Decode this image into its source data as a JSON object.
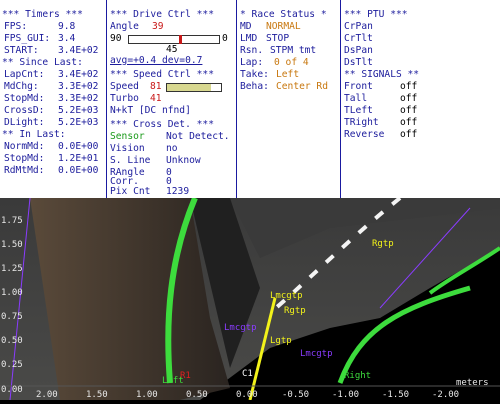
{
  "timers": {
    "title": "*** Timers ***",
    "fps_label": "FPS:",
    "fps": "9.8",
    "fps_gui_label": "FPS_GUI:",
    "fps_gui": "3.4",
    "start_label": "START:",
    "start": "3.4E+02",
    "since_title": "** Since Last:",
    "lapcnt_label": "LapCnt:",
    "lapcnt": "3.4E+02",
    "mdchg_label": "MdChg:",
    "mdchg": "3.3E+02",
    "stopmd_label": "StopMd:",
    "stopmd": "3.3E+02",
    "crossd_label": "CrossD:",
    "crossd": "5.2E+03",
    "dlight_label": "DLight:",
    "dlight": "5.2E+03",
    "inlast_title": "** In Last:",
    "normmd_label": "NormMd:",
    "normmd": "0.0E+00",
    "stopmd2_label": "StopMd:",
    "stopmd2": "1.2E+01",
    "rdmtmd_label": "RdMtMd:",
    "rdmtmd": "0.0E+00"
  },
  "drive": {
    "title": "*** Drive Ctrl ***",
    "angle_label": "Angle",
    "angle": "39",
    "range_min": "90",
    "range_max": "0",
    "mid": "45",
    "avg": "avg=+0.4 dev=0.7",
    "angle_fraction": 0.55,
    "speed_title": "*** Speed Ctrl ***",
    "speed_label": "Speed",
    "speed": "81",
    "speed_fraction": 0.81,
    "turbo_label": "Turbo",
    "turbo": "41",
    "nkt": "N+kT [DC nfnd]",
    "cross_title": "*** Cross Det. ***",
    "sensor_label": "Sensor",
    "sensor": "Not Detect.",
    "vision_label": "Vision",
    "vision": "no",
    "sline_label": "S. Line",
    "sline": "Unknow",
    "rangle_label": "RAngle",
    "rangle": "0",
    "corr_label": "Corr.",
    "corr": "0",
    "pix_label": "Pix Cnt",
    "pix": "1239"
  },
  "race": {
    "title": "* Race Status *",
    "md_label": "MD",
    "md": "NORMAL",
    "lmd_label": "LMD",
    "lmd": "STOP",
    "rsn_label": "Rsn.",
    "rsn": "STPM tmt",
    "lap_label": "Lap:",
    "lap": "0 of 4",
    "take_label": "Take:",
    "take": "Left",
    "beha_label": "Beha:",
    "beha": "Center Rd"
  },
  "ptu": {
    "title": "*** PTU ***",
    "items": [
      "CrPan",
      "CrTlt",
      "DsPan",
      "DsTlt"
    ],
    "signals_title": "** SIGNALS **",
    "front_label": "Front",
    "front": "off",
    "tall_label": "Tall",
    "tall": "off",
    "tleft_label": "TLeft",
    "tleft": "off",
    "tright_label": "TRight",
    "tright": "off",
    "reverse_label": "Reverse",
    "reverse": "off"
  },
  "camera": {
    "y_ticks": [
      "1.75",
      "1.50",
      "1.25",
      "1.00",
      "0.75",
      "0.50",
      "0.25",
      "0.00"
    ],
    "x_ticks": [
      "2.00",
      "1.50",
      "1.00",
      "0.50",
      "0.00",
      "-0.50",
      "-1.00",
      "-1.50",
      "-2.00"
    ],
    "units": "meters",
    "labels": {
      "rgtp": "Rgtp",
      "lmcgtp": "Lmcgtp",
      "rgtp2": "Rgtp",
      "lgtp": "Lgtp",
      "lmcgtp2": "Lmcgtp",
      "left": "Left",
      "right": "Right",
      "r1": "R1",
      "c1": "C1"
    }
  },
  "colors": {
    "panel_text": "#1c1c9c",
    "value_red": "#c81818",
    "value_orange": "#c87810",
    "sensor_green": "#1a9a1a",
    "lane_green": "#3ddc3d",
    "marker_yellow": "#f2f21a",
    "marker_purple": "#8a3cff"
  }
}
